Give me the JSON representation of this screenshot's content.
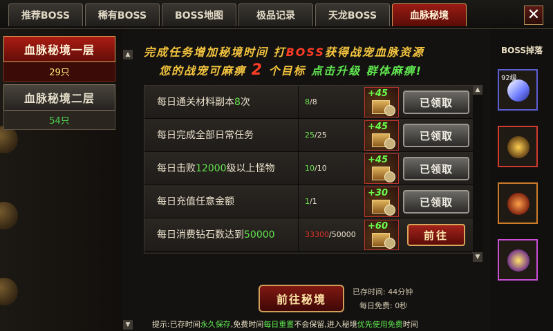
{
  "tabs": [
    {
      "label": "推荐BOSS",
      "active": false
    },
    {
      "label": "稀有BOSS",
      "active": false
    },
    {
      "label": "BOSS地图",
      "active": false
    },
    {
      "label": "极品记录",
      "active": false
    },
    {
      "label": "天龙BOSS",
      "active": false
    },
    {
      "label": "血脉秘境",
      "active": true
    }
  ],
  "close_label": "✕",
  "floors": [
    {
      "title": "血脉秘境一层",
      "count": "29只",
      "active": true
    },
    {
      "title": "血脉秘境二层",
      "count": "54只",
      "active": false
    }
  ],
  "headline": {
    "line1_a": "完成任务增加秘境时间  打",
    "line1_boss": "BOSS",
    "line1_b": "获得战宠血脉资源",
    "line2_a": "您的战宠可麻痹",
    "line2_num": "2",
    "line2_b": "个目标",
    "line2_c": "点击升级",
    "line2_d": "群体麻痹!"
  },
  "tasks": [
    {
      "pre": "每日通关材料副本",
      "num": "8",
      "post": "次",
      "cur": "8",
      "total": "/8",
      "reward": "+45",
      "button": "已领取",
      "state": "claimed"
    },
    {
      "pre": "每日完成全部日常任务",
      "num": "",
      "post": "",
      "cur": "25",
      "total": "/25",
      "reward": "+45",
      "button": "已领取",
      "state": "claimed"
    },
    {
      "pre": "每日击败",
      "num": "12000",
      "post": "级以上怪物",
      "cur": "10",
      "total": "/10",
      "reward": "+45",
      "button": "已领取",
      "state": "claimed"
    },
    {
      "pre": "每日充值任意金额",
      "num": "",
      "post": "",
      "cur": "1",
      "total": "/1",
      "reward": "+30",
      "button": "已领取",
      "state": "claimed"
    },
    {
      "pre": "每日消费钻石数达到",
      "num": "50000",
      "post": "",
      "cur": "33300",
      "total": "/50000",
      "reward": "+60",
      "button": "前往",
      "state": "go"
    }
  ],
  "scroll": {
    "up": "▲",
    "down": "▼"
  },
  "go_realm_label": "前往秘境",
  "time_label": "已存时间: 44分钟",
  "free_label": "每日免费: 0秒",
  "tip": {
    "a": "提示:已存时间",
    "b": "永久保存",
    "c": ",免费时间",
    "d": "每日重置",
    "e": "不会保留,进入秘境",
    "f": "优先使用免费",
    "g": "时间"
  },
  "drops": {
    "title": "BOSS掉落",
    "items": [
      {
        "icon": "sword-icon",
        "level": "92级"
      },
      {
        "icon": "armor-icon",
        "level": ""
      },
      {
        "icon": "gem-icon",
        "level": ""
      },
      {
        "icon": "orb-icon",
        "level": ""
      }
    ]
  },
  "colors": {
    "accent_red": "#9a1b14",
    "gold": "#f5c53f",
    "green": "#5fe54f",
    "red_text": "#ff3d27"
  }
}
